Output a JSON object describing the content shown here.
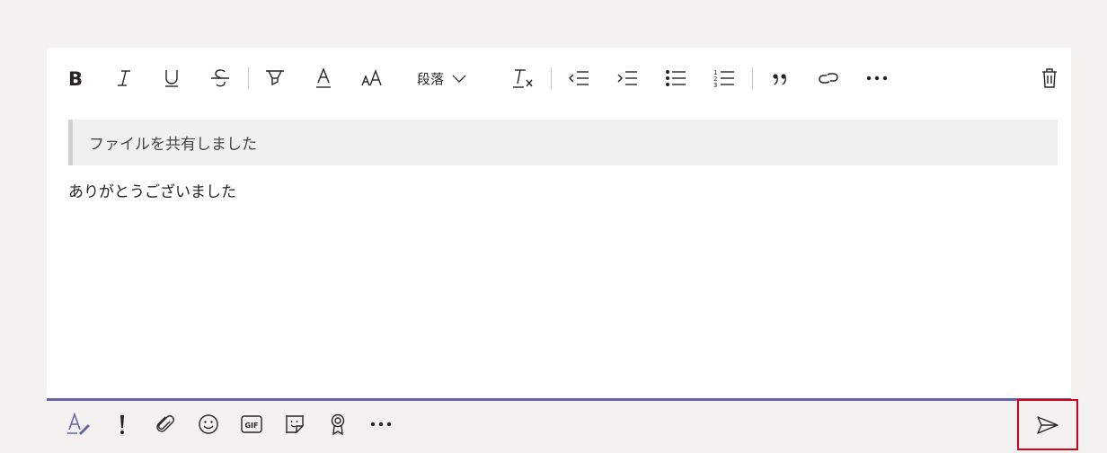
{
  "toolbar": {
    "paragraph_label": "段落",
    "icons": [
      "bold-icon",
      "italic-icon",
      "underline-icon",
      "strikethrough-icon",
      "highlight-icon",
      "font-color-icon",
      "font-size-icon",
      "paragraph-dropdown",
      "clear-formatting-icon",
      "decrease-indent-icon",
      "increase-indent-icon",
      "bulleted-list-icon",
      "numbered-list-icon",
      "quote-icon",
      "link-icon",
      "more-options-icon",
      "delete-icon"
    ]
  },
  "message": {
    "quoted_text": "ファイルを共有しました",
    "body_text": "ありがとうございました"
  },
  "bottom_bar": {
    "gif_label": "GIF",
    "icons": [
      "format-icon",
      "important-icon",
      "attach-icon",
      "emoji-icon",
      "gif-icon",
      "sticker-icon",
      "praise-icon",
      "more-icon",
      "send-icon"
    ]
  },
  "colors": {
    "accent": "#6264a7",
    "highlight_box": "#d0021b",
    "background": "#f3f2f1"
  }
}
